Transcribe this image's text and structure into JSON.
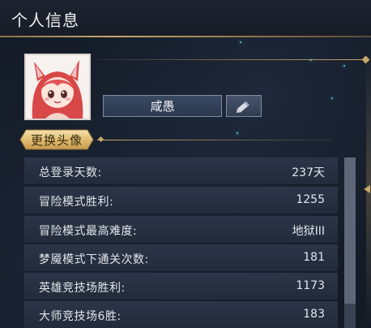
{
  "header": {
    "title": "个人信息"
  },
  "profile": {
    "name": "咸愚",
    "change_avatar_label": "更换头像"
  },
  "stats": [
    {
      "label": "总登录天数:",
      "value": "237天"
    },
    {
      "label": "冒险模式胜利:",
      "value": "1255"
    },
    {
      "label": "冒险模式最高难度:",
      "value": "地狱III"
    },
    {
      "label": "梦魇模式下通关次数:",
      "value": "181"
    },
    {
      "label": "英雄竞技场胜利:",
      "value": "1173"
    },
    {
      "label": "大师竞技场6胜:",
      "value": "183"
    }
  ],
  "colors": {
    "accent_gold": "#c9a86a",
    "row_bg": "#2b3547",
    "background": "#141b27"
  },
  "icons": {
    "edit": "pencil-icon",
    "avatar": "fox-girl-portrait"
  }
}
